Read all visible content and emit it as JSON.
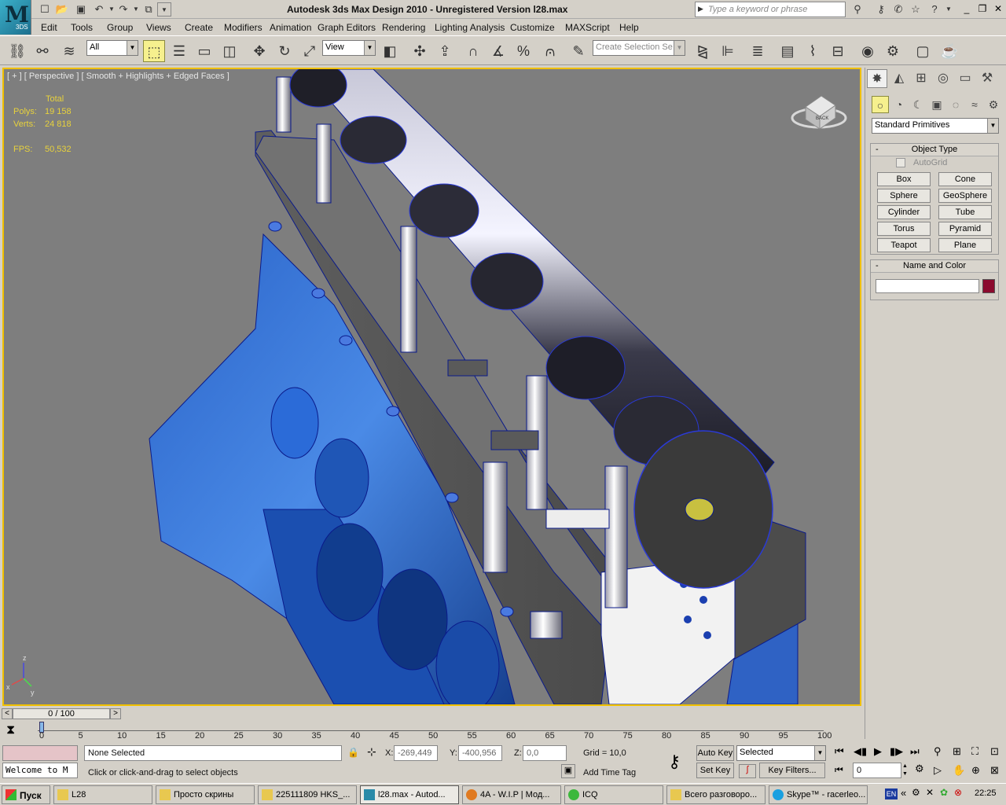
{
  "app": {
    "logo_label": "3DS",
    "title": "Autodesk 3ds Max Design 2010   - Unregistered Version      l28.max",
    "search_placeholder": "Type a keyword or phrase"
  },
  "menu": [
    "Edit",
    "Tools",
    "Group",
    "Views",
    "Create",
    "Modifiers",
    "Animation",
    "Graph Editors",
    "Rendering",
    "Lighting Analysis",
    "Customize",
    "MAXScript",
    "Help"
  ],
  "toolbar": {
    "selection_filter": "All",
    "ref_coord": "View",
    "create_selection_set": "Create Selection Se"
  },
  "viewport": {
    "label": "[ + ] [ Perspective ] [ Smooth + Highlights + Edged Faces ]",
    "stats_header": "Total",
    "polys_label": "Polys:",
    "polys_value": "19 158",
    "verts_label": "Verts:",
    "verts_value": "24 818",
    "fps_label": "FPS:",
    "fps_value": "50,532",
    "viewcube_label": "BACK",
    "axis_z": "z",
    "axis_x": "x",
    "axis_y": "y"
  },
  "command_panel": {
    "category": "Standard Primitives",
    "object_type_title": "Object Type",
    "autogrid_label": "AutoGrid",
    "autogrid_checked": false,
    "buttons": [
      "Box",
      "Cone",
      "Sphere",
      "GeoSphere",
      "Cylinder",
      "Tube",
      "Torus",
      "Pyramid",
      "Teapot",
      "Plane"
    ],
    "name_color_title": "Name and Color",
    "name_value": "",
    "object_color": "#8b0a2e"
  },
  "timeline": {
    "frame_display": "0 / 100",
    "ticks": [
      "0",
      "5",
      "10",
      "15",
      "20",
      "25",
      "30",
      "35",
      "40",
      "45",
      "50",
      "55",
      "60",
      "65",
      "70",
      "75",
      "80",
      "85",
      "90",
      "95",
      "100"
    ]
  },
  "status": {
    "selection": "None Selected",
    "prompt": "Click or click-and-drag to select objects",
    "maxscript_listener": "Welcome to M",
    "x_label": "X:",
    "x_value": "-269,449",
    "y_label": "Y:",
    "y_value": "-400,956",
    "z_label": "Z:",
    "z_value": "0,0",
    "grid": "Grid = 10,0",
    "add_time_tag": "Add Time Tag",
    "auto_key": "Auto Key",
    "set_key": "Set Key",
    "key_mode": "Selected",
    "key_filters": "Key Filters...",
    "current_frame": "0"
  },
  "taskbar": {
    "start_label": "Пуск",
    "tasks": [
      "L28",
      "Просто скрины",
      "225111809 HKS_...",
      "l28.max - Autod...",
      "4A - W.I.P | Мод...",
      "ICQ",
      "Всего разговоро...",
      "Skype™ - racerleo..."
    ],
    "language": "EN",
    "clock": "22:25"
  }
}
